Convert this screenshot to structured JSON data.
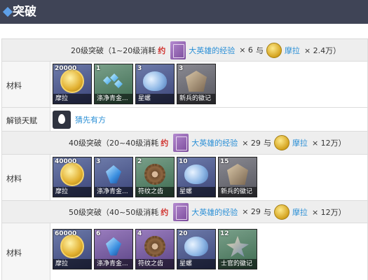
{
  "header": {
    "title": "突破"
  },
  "labels": {
    "materials": "材料",
    "unlock_talent": "解锁天赋",
    "consume_mark": "约",
    "with": "与"
  },
  "sections": [
    {
      "heading": "20级突破（1~20级消耗",
      "exp_item": "大英雄的经验",
      "exp_qty": "× 6",
      "mora_item": "摩拉",
      "mora_qty": "× 2.4万）",
      "materials": [
        {
          "count": "20000",
          "name": "摩拉",
          "art": "coin",
          "bg": "blue"
        },
        {
          "count": "1",
          "name": "涤净青金...",
          "art": "gems",
          "bg": "green"
        },
        {
          "count": "3",
          "name": "星螺",
          "art": "conch",
          "bg": "blue"
        },
        {
          "count": "3",
          "name": "新兵的徽记",
          "art": "badge",
          "bg": "gray"
        }
      ],
      "talent": {
        "name": "猜先有方"
      }
    },
    {
      "heading": "40级突破（20~40级消耗",
      "exp_item": "大英雄的经验",
      "exp_qty": "× 29",
      "mora_item": "摩拉",
      "mora_qty": "× 12万）",
      "materials": [
        {
          "count": "40000",
          "name": "摩拉",
          "art": "coin",
          "bg": "blue"
        },
        {
          "count": "3",
          "name": "涤净青金...",
          "art": "gem",
          "bg": "blue"
        },
        {
          "count": "2",
          "name": "符纹之齿",
          "art": "gear",
          "bg": "green"
        },
        {
          "count": "10",
          "name": "星螺",
          "art": "conch",
          "bg": "blue"
        },
        {
          "count": "15",
          "name": "新兵的徽记",
          "art": "badge",
          "bg": "gray"
        }
      ]
    },
    {
      "heading": "50级突破（40~50级消耗",
      "exp_item": "大英雄的经验",
      "exp_qty": "× 29",
      "mora_item": "摩拉",
      "mora_qty": "× 12万）",
      "materials": [
        {
          "count": "60000",
          "name": "摩拉",
          "art": "coin",
          "bg": "blue"
        },
        {
          "count": "6",
          "name": "涤净青金...",
          "art": "gem",
          "bg": "purple"
        },
        {
          "count": "4",
          "name": "符纹之齿",
          "art": "gear",
          "bg": "purple"
        },
        {
          "count": "20",
          "name": "星螺",
          "art": "conch",
          "bg": "blue"
        },
        {
          "count": "12",
          "name": "士官的徽记",
          "art": "officer",
          "bg": "green"
        }
      ]
    }
  ]
}
